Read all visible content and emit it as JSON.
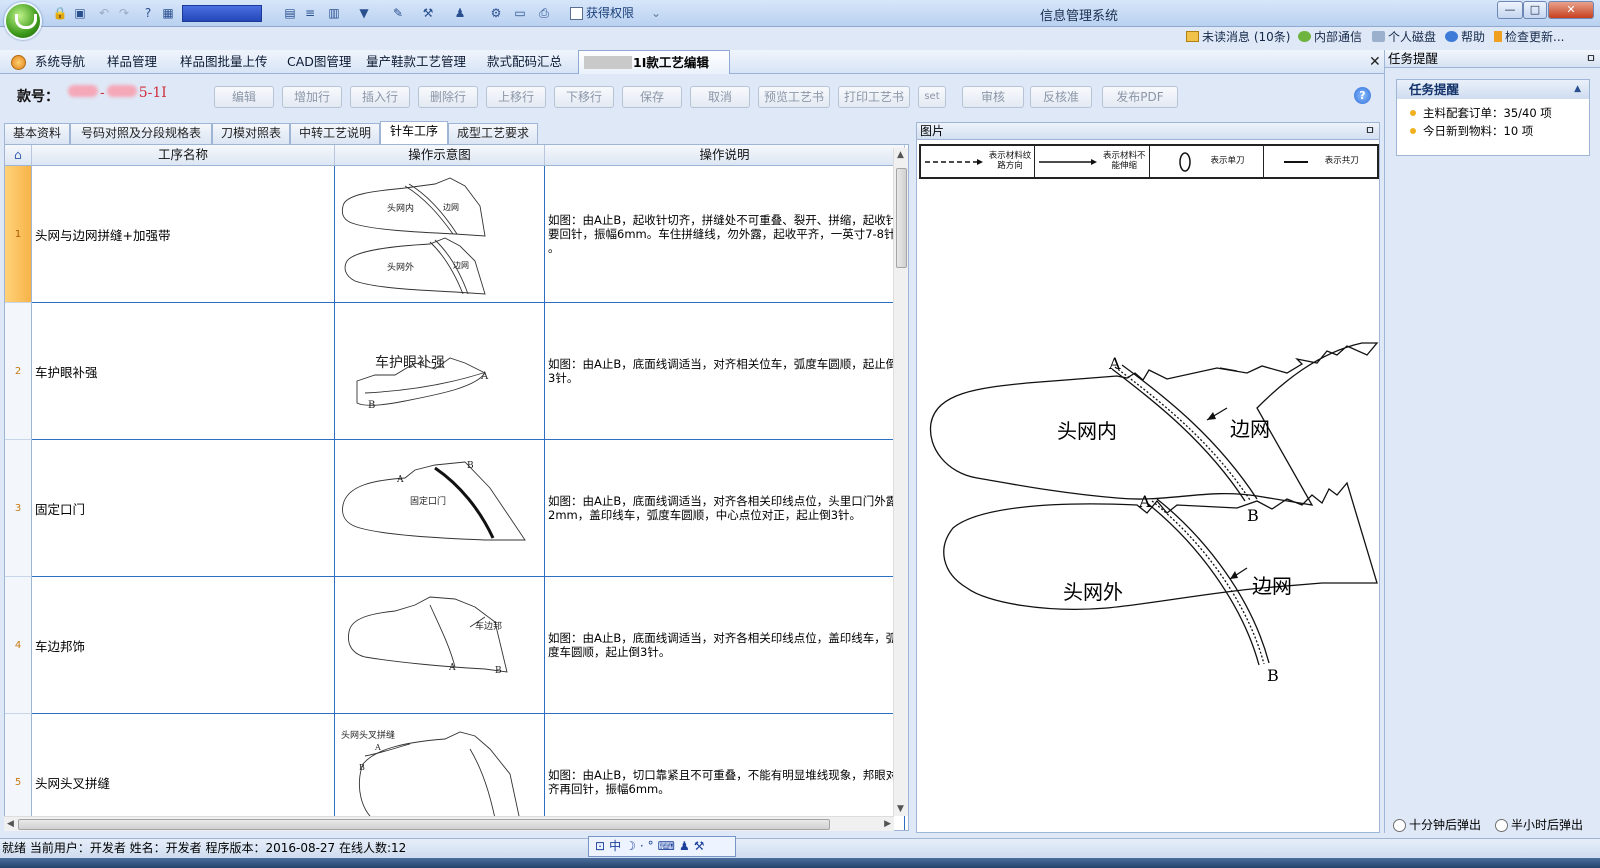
{
  "window": {
    "title": "信息管理系统",
    "get_permission": "获得权限",
    "minimize": "—",
    "maximize": "□",
    "close": "✕"
  },
  "info_bar": {
    "unread": "未读消息 (10条)",
    "internal": "内部通信",
    "disk": "个人磁盘",
    "help": "帮助",
    "update": "检查更新..."
  },
  "menu": {
    "items": [
      "系统导航",
      "样品管理",
      "样品图批量上传",
      "CAD图管理",
      "量产鞋款工艺管理",
      "款式配码汇总"
    ],
    "active_tab": "1I款工艺编辑",
    "close": "✕"
  },
  "toolbar": {
    "style_label": "款号：",
    "style_value_suffix": "5-1I",
    "buttons": [
      "编辑",
      "增加行",
      "插入行",
      "删除行",
      "上移行",
      "下移行",
      "保存",
      "取消",
      "预览工艺书",
      "打印工艺书",
      "set",
      "审核",
      "反核准",
      "发布PDF"
    ]
  },
  "subtabs": [
    "基本资料",
    "号码对照及分段规格表",
    "刀模对照表",
    "中转工艺说明",
    "针车工序",
    "成型工艺要求"
  ],
  "grid": {
    "headers": [
      "工序名称",
      "操作示意图",
      "操作说明"
    ],
    "rows": [
      {
        "num": "1",
        "name": "头网与边网拼缝+加强带",
        "desc": "如图：由A止B，起收针切齐，拼缝处不可重叠、裂开、拼缩，起收针要回针，振幅6mm。车住拼缝线，勿外露，起收平齐，一英寸7-8针 。",
        "labels": [
          "头网内",
          "边网",
          "头网外",
          "边网"
        ]
      },
      {
        "num": "2",
        "name": "车护眼补强",
        "desc": "如图：由A止B，底面线调适当，对齐相关位车，弧度车圆顺，起止倒3针。",
        "labels": [
          "车护眼补强"
        ]
      },
      {
        "num": "3",
        "name": "固定口门",
        "desc": "如图：由A止B，底面线调适当，对齐各相关印线点位，头里口门外露2mm，盖印线车，弧度车圆顺，中心点位对正，起止倒3针。",
        "labels": [
          "固定口门"
        ]
      },
      {
        "num": "4",
        "name": "车边邦饰",
        "desc": "如图：由A止B，底面线调适当，对齐各相关印线点位，盖印线车，弧度车圆顺，起止倒3针。",
        "labels": [
          "车边邦"
        ]
      },
      {
        "num": "5",
        "name": "头网头叉拼缝",
        "desc": "如图：由A止B，切口靠紧且不可重叠，不能有明显堆线现象，邦眼对齐再回针，振幅6mm。",
        "labels": [
          "头网头叉拼缝"
        ]
      }
    ]
  },
  "picture": {
    "title": "图片",
    "pin": "ㅁ",
    "legend": [
      "表示材料纹路方向",
      "表示材料不能伸缩",
      "表示单刀",
      "表示共刀"
    ],
    "labels": {
      "inner": "头网内",
      "outer": "头网外",
      "edge1": "边网",
      "edge2": "边网",
      "a": "A",
      "b": "B"
    }
  },
  "task_panel": {
    "title": "任务提醒",
    "box_title": "任务提醒",
    "lines": [
      "主料配套订单：35/40 项",
      "今日新到物料：10 项"
    ],
    "radios": [
      "十分钟后弹出",
      "半小时后弹出"
    ]
  },
  "status": {
    "text": "就绪  当前用户：开发者  姓名：开发者  程序版本：2016-08-27  在线人数:12",
    "ime": "中"
  },
  "colors": {
    "accent": "#2f6fc2",
    "highlight": "#f7b347",
    "masked": "#d1303e"
  }
}
